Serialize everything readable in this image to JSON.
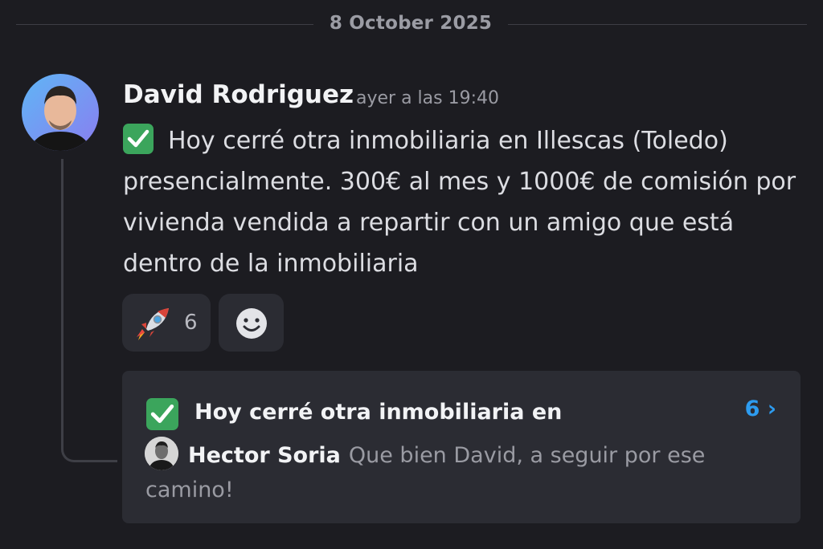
{
  "divider": {
    "date": "8 October 2025"
  },
  "message": {
    "author": "David Rodriguez",
    "timestamp": "ayer a las 19:40",
    "text": "Hoy cerré otra inmobiliaria en Illescas (Toledo) presencialmente. 300€ al mes y 1000€ de comisión por vivienda vendida a repartir con un amigo que está dentro de la inmobiliaria",
    "leading_icon": "check-mark-icon"
  },
  "reactions": [
    {
      "icon": "rocket-icon",
      "count": "6"
    },
    {
      "icon": "add-reaction-icon"
    }
  ],
  "thread": {
    "title": "Hoy cerré otra inmobiliaria en",
    "message_count": "6 ›",
    "last_reply": {
      "author": "Hector Soria",
      "text": "Que bien David, a seguir por ese camino!"
    }
  },
  "colors": {
    "background": "#1c1c21",
    "card": "#2b2c33",
    "check_green": "#3ba55c",
    "link_blue": "#2d9cf0"
  }
}
